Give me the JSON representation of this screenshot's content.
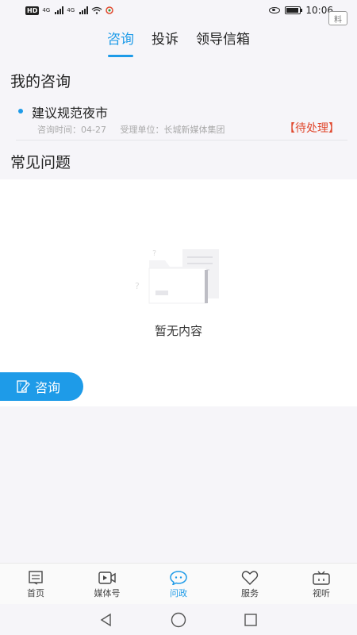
{
  "status_bar": {
    "badge": "HD",
    "signal1": "4G",
    "signal2": "4G",
    "time": "10:06"
  },
  "top_tabs": [
    {
      "label": "咨询",
      "active": true
    },
    {
      "label": "投诉",
      "active": false
    },
    {
      "label": "领导信箱",
      "active": false
    }
  ],
  "material_button": "料",
  "my_consult": {
    "title": "我的咨询",
    "items": [
      {
        "title": "建议规范夜市",
        "time_label": "咨询时间：04-27",
        "unit_label": "受理单位：长城新媒体集团",
        "status": "【待处理】"
      }
    ]
  },
  "faq": {
    "title": "常见问题",
    "empty_text": "暂无内容"
  },
  "fab": {
    "label": "咨询"
  },
  "bottom_nav": [
    {
      "label": "首页",
      "icon": "home-icon",
      "active": false
    },
    {
      "label": "媒体号",
      "icon": "video-icon",
      "active": false
    },
    {
      "label": "问政",
      "icon": "chat-icon",
      "active": true
    },
    {
      "label": "服务",
      "icon": "heart-icon",
      "active": false
    },
    {
      "label": "视听",
      "icon": "tv-icon",
      "active": false
    }
  ],
  "colors": {
    "accent": "#1e9be8",
    "status_pending": "#e0492f",
    "background": "#f6f5f9"
  }
}
